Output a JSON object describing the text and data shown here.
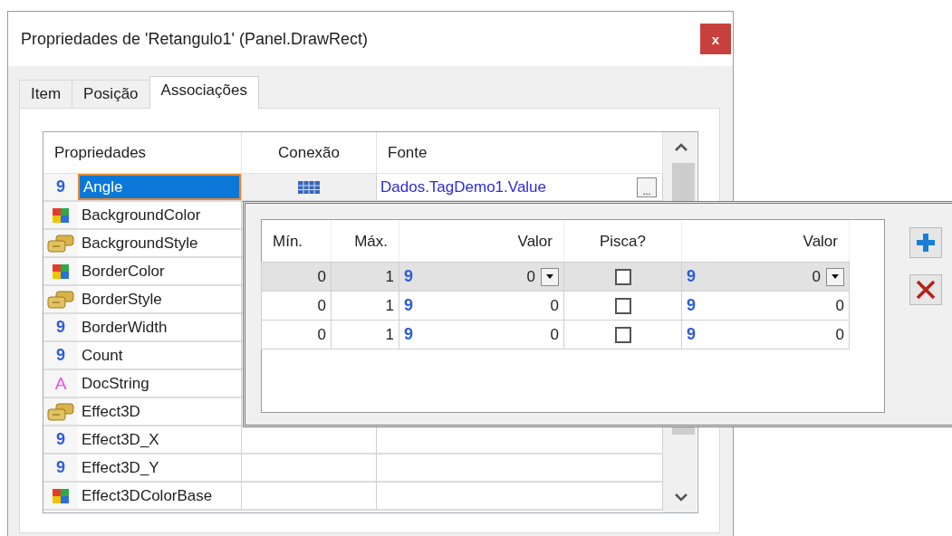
{
  "window": {
    "title": "Propriedades de 'Retangulo1' (Panel.DrawRect)",
    "close": "x"
  },
  "tabs": [
    {
      "label": "Item",
      "selected": false
    },
    {
      "label": "Posição",
      "selected": false
    },
    {
      "label": "Associações",
      "selected": true
    }
  ],
  "grid": {
    "columns": [
      "Propriedades",
      "Conexão",
      "Fonte"
    ],
    "rows": [
      {
        "name": "Angle",
        "kind": "number",
        "glyph": "9",
        "selected": true,
        "connected": true,
        "source": "Dados.TagDemo1.Value",
        "browse": "..."
      },
      {
        "name": "BackgroundColor",
        "kind": "color",
        "selected": false,
        "connected": false
      },
      {
        "name": "BackgroundStyle",
        "kind": "style",
        "selected": false,
        "connected": false
      },
      {
        "name": "BorderColor",
        "kind": "color",
        "selected": false,
        "connected": false
      },
      {
        "name": "BorderStyle",
        "kind": "style",
        "selected": false,
        "connected": false
      },
      {
        "name": "BorderWidth",
        "kind": "number",
        "glyph": "9",
        "selected": false,
        "connected": false
      },
      {
        "name": "Count",
        "kind": "number",
        "glyph": "9",
        "selected": false,
        "connected": false
      },
      {
        "name": "DocString",
        "kind": "text",
        "glyph": "A",
        "selected": false,
        "connected": false
      },
      {
        "name": "Effect3D",
        "kind": "style",
        "selected": false,
        "connected": false
      },
      {
        "name": "Effect3D_X",
        "kind": "number",
        "glyph": "9",
        "selected": false,
        "connected": false
      },
      {
        "name": "Effect3D_Y",
        "kind": "number",
        "glyph": "9",
        "selected": false,
        "connected": false
      },
      {
        "name": "Effect3DColorBase",
        "kind": "color",
        "selected": false,
        "connected": false
      }
    ]
  },
  "popup": {
    "columns": [
      "Mín.",
      "Máx.",
      "Valor",
      "Pisca?",
      "Valor"
    ],
    "rows": [
      {
        "min": "0",
        "max": "1",
        "glyph": "9",
        "value": "0",
        "blink": false,
        "glyph2": "9",
        "value2": "0",
        "selected": true
      },
      {
        "min": "0",
        "max": "1",
        "glyph": "9",
        "value": "0",
        "blink": false,
        "glyph2": "9",
        "value2": "0",
        "selected": false
      },
      {
        "min": "0",
        "max": "1",
        "glyph": "9",
        "value": "0",
        "blink": false,
        "glyph2": "9",
        "value2": "0",
        "selected": false
      }
    ]
  }
}
